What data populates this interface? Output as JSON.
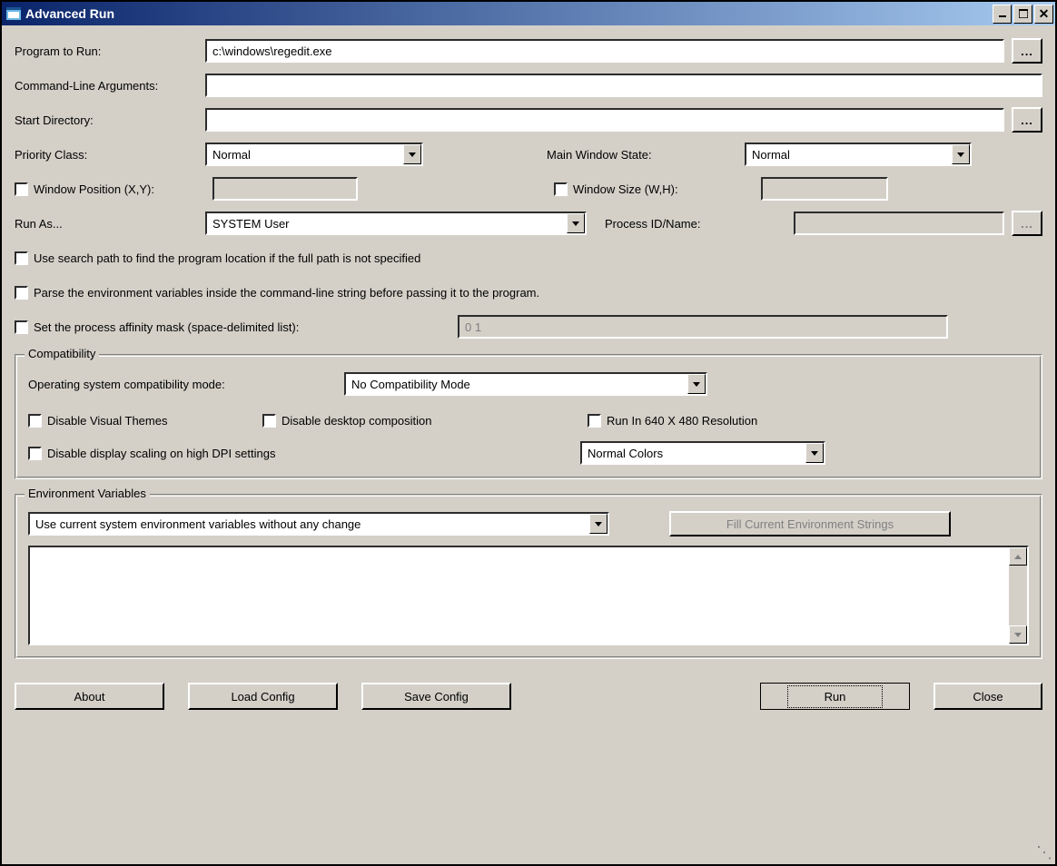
{
  "window": {
    "title": "Advanced Run"
  },
  "labels": {
    "program": "Program to Run:",
    "args": "Command-Line Arguments:",
    "startdir": "Start Directory:",
    "priority": "Priority Class:",
    "winstate": "Main Window State:",
    "winpos": "Window Position (X,Y):",
    "winsize": "Window Size (W,H):",
    "runas": "Run As...",
    "procid": "Process ID/Name:"
  },
  "values": {
    "program": "c:\\windows\\regedit.exe",
    "args": "",
    "startdir": "",
    "priority": "Normal",
    "winstate": "Normal",
    "winpos": "",
    "winsize": "",
    "runas": "SYSTEM User",
    "procid": "",
    "affinity": "0 1",
    "compatmode": "No Compatibility Mode",
    "colors": "Normal Colors",
    "envmode": "Use current system environment variables without any change"
  },
  "checkboxes": {
    "searchpath": "Use search path to find the program location if the full path is not specified",
    "parseenv": "Parse the environment variables inside the command-line string before passing it to the program.",
    "affinity": "Set the process affinity mask (space-delimited list):",
    "disablethemes": "Disable Visual Themes",
    "disablecomp": "Disable desktop composition",
    "run640": "Run In 640 X 480 Resolution",
    "disabledpi": "Disable display scaling on high DPI settings"
  },
  "groups": {
    "compat": "Compatibility",
    "compatmode_label": "Operating system compatibility mode:",
    "env": "Environment Variables"
  },
  "buttons": {
    "browse": "...",
    "fillenv": "Fill Current Environment Strings",
    "about": "About",
    "loadcfg": "Load Config",
    "savecfg": "Save Config",
    "run": "Run",
    "close": "Close"
  }
}
